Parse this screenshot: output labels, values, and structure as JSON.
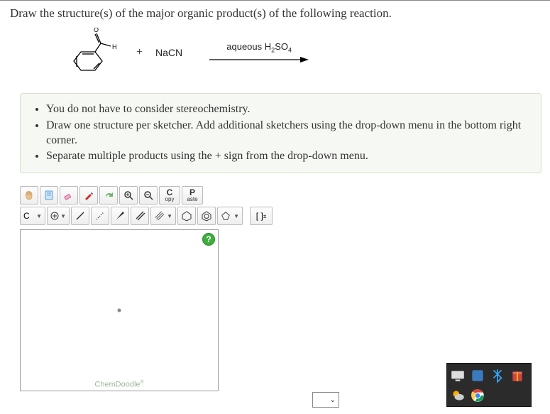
{
  "question": {
    "prompt": "Draw the structure(s) of the major organic product(s) of the following reaction."
  },
  "reaction": {
    "plus": "+",
    "reagent": "NaCN",
    "arrow_label_pre": "aqueous H",
    "arrow_label_sub1": "2",
    "arrow_label_mid": "SO",
    "arrow_label_sub2": "4"
  },
  "notes": {
    "items": [
      "You do not have to consider stereochemistry.",
      "Draw one structure per sketcher. Add additional sketchers using the drop-down menu in the bottom right corner.",
      "Separate multiple products using the + sign from the drop-down menu."
    ]
  },
  "toolbar": {
    "copy_top": "C",
    "copy_bottom": "opy",
    "paste_top": "P",
    "paste_bottom": "aste",
    "element": "C",
    "charge": "[ ]",
    "charge_sup": "±"
  },
  "sketcher": {
    "brand": "ChemDoodle",
    "help": "?"
  }
}
